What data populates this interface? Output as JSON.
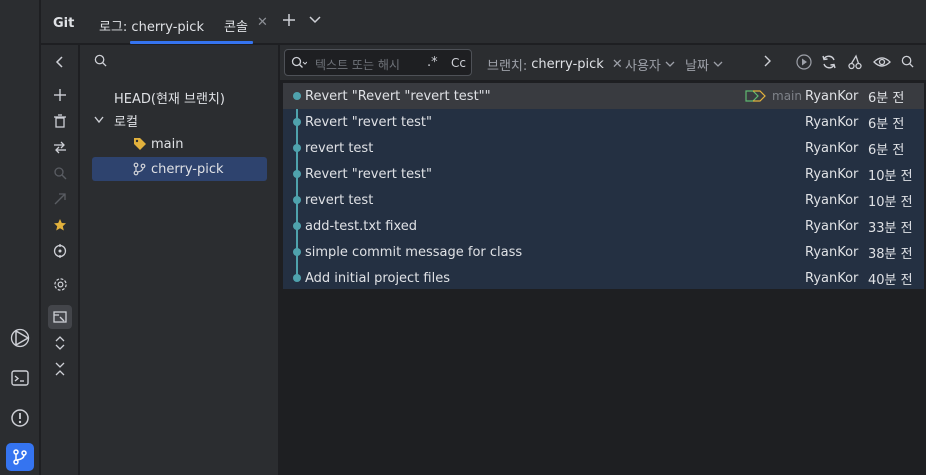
{
  "tabs": {
    "git_label": "Git",
    "log_tab": "로그: cherry-pick",
    "console_tab": "콘솔"
  },
  "tree": {
    "head_label": "HEAD(현재 브랜치)",
    "local_label": "로컬",
    "branches": [
      "main",
      "cherry-pick"
    ]
  },
  "filter": {
    "search_placeholder": "텍스트 또는 해시",
    "regex_label": ".*",
    "case_label": "Cc",
    "branch_prefix": "브랜치:",
    "branch_value": "cherry-pick",
    "user_label": "사용자",
    "date_label": "날짜"
  },
  "commits": [
    {
      "message": "Revert \"Revert \"revert test\"\"",
      "author": "RyanKor",
      "date": "6분 전",
      "ref": "main"
    },
    {
      "message": "Revert \"revert test\"",
      "author": "RyanKor",
      "date": "6분 전"
    },
    {
      "message": "revert test",
      "author": "RyanKor",
      "date": "6분 전"
    },
    {
      "message": "Revert \"revert test\"",
      "author": "RyanKor",
      "date": "10분 전"
    },
    {
      "message": "revert test",
      "author": "RyanKor",
      "date": "10분 전"
    },
    {
      "message": "add-test.txt fixed",
      "author": "RyanKor",
      "date": "33분 전"
    },
    {
      "message": "simple commit message for class",
      "author": "RyanKor",
      "date": "38분 전"
    },
    {
      "message": "Add initial project files",
      "author": "RyanKor",
      "date": "40분 전"
    }
  ],
  "colors": {
    "accent": "#3574f0",
    "graph": "#4fa2ad",
    "selected_bg": "#2e436e",
    "commit_bg": "#243042",
    "tag_color": "#e2b13c",
    "ref_color": "#5fb870"
  }
}
